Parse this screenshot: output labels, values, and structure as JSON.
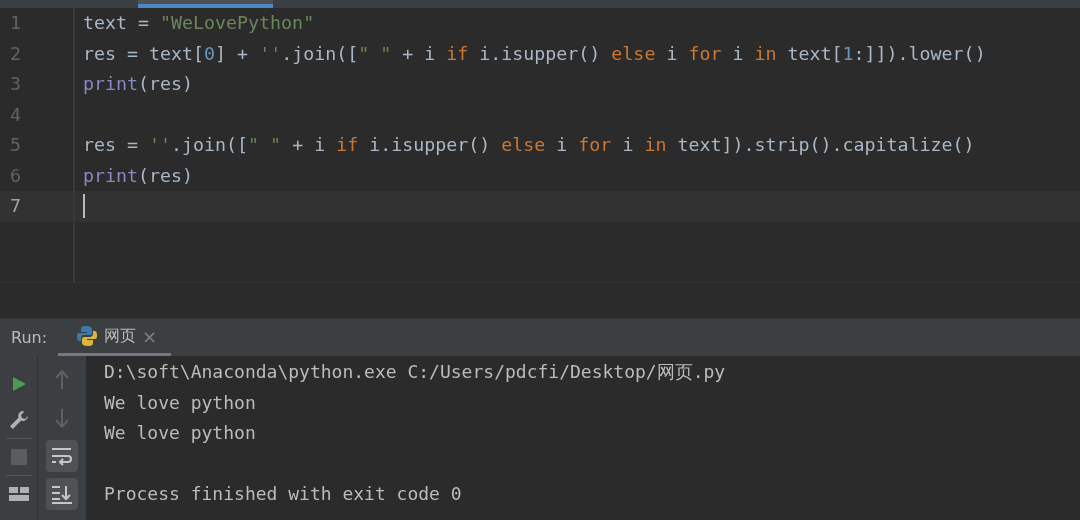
{
  "editor": {
    "tabs": [
      {
        "selected": true
      }
    ],
    "lines": [
      {
        "number": "1",
        "current": false,
        "tokens": [
          {
            "kind": "plain",
            "text": "text = "
          },
          {
            "kind": "string",
            "text": "\"WeLovePython\""
          }
        ]
      },
      {
        "number": "2",
        "current": false,
        "tokens": [
          {
            "kind": "plain",
            "text": "res = text["
          },
          {
            "kind": "number",
            "text": "0"
          },
          {
            "kind": "plain",
            "text": "] + "
          },
          {
            "kind": "string",
            "text": "''"
          },
          {
            "kind": "plain",
            "text": ".join(["
          },
          {
            "kind": "string",
            "text": "\" \""
          },
          {
            "kind": "plain",
            "text": " + i "
          },
          {
            "kind": "keyword",
            "text": "if"
          },
          {
            "kind": "plain",
            "text": " i.isupper() "
          },
          {
            "kind": "keyword",
            "text": "else"
          },
          {
            "kind": "plain",
            "text": " i "
          },
          {
            "kind": "keyword",
            "text": "for"
          },
          {
            "kind": "plain",
            "text": " i "
          },
          {
            "kind": "keyword",
            "text": "in"
          },
          {
            "kind": "plain",
            "text": " text["
          },
          {
            "kind": "number",
            "text": "1"
          },
          {
            "kind": "plain",
            "text": ":]]).lower()"
          }
        ]
      },
      {
        "number": "3",
        "current": false,
        "tokens": [
          {
            "kind": "builtin",
            "text": "print"
          },
          {
            "kind": "plain",
            "text": "(res)"
          }
        ]
      },
      {
        "number": "4",
        "current": false
      },
      {
        "number": "5",
        "current": false,
        "tokens": [
          {
            "kind": "plain",
            "text": "res = "
          },
          {
            "kind": "string",
            "text": "''"
          },
          {
            "kind": "plain",
            "text": ".join(["
          },
          {
            "kind": "string",
            "text": "\" \""
          },
          {
            "kind": "plain",
            "text": " + i "
          },
          {
            "kind": "keyword",
            "text": "if"
          },
          {
            "kind": "plain",
            "text": " i.isupper() "
          },
          {
            "kind": "keyword",
            "text": "else"
          },
          {
            "kind": "plain",
            "text": " i "
          },
          {
            "kind": "keyword",
            "text": "for"
          },
          {
            "kind": "plain",
            "text": " i "
          },
          {
            "kind": "keyword",
            "text": "in"
          },
          {
            "kind": "plain",
            "text": " text]).strip().capitalize()"
          }
        ]
      },
      {
        "number": "6",
        "current": false,
        "tokens": [
          {
            "kind": "builtin",
            "text": "print"
          },
          {
            "kind": "plain",
            "text": "(res)"
          }
        ]
      },
      {
        "number": "7",
        "current": true
      }
    ]
  },
  "run_panel": {
    "label": "Run:",
    "tabs": [
      {
        "label": "网页",
        "close": "×",
        "selected": true
      }
    ],
    "left_toolbar": [
      {
        "kind": "run",
        "disabled": false
      },
      {
        "kind": "wrench",
        "disabled": false
      },
      {
        "kind": "stop",
        "disabled": true
      },
      {
        "kind": "layout",
        "disabled": false
      }
    ],
    "right_toolbar": [
      {
        "kind": "up",
        "on": false
      },
      {
        "kind": "down",
        "on": false
      },
      {
        "kind": "wrap",
        "on": true
      },
      {
        "kind": "scroll-end",
        "on": true
      }
    ],
    "output": [
      "D:\\soft\\Anaconda\\python.exe C:/Users/pdcfi/Desktop/网页.py",
      "We love python",
      "We love python"
    ],
    "exit_message": "Process finished with exit code 0"
  }
}
